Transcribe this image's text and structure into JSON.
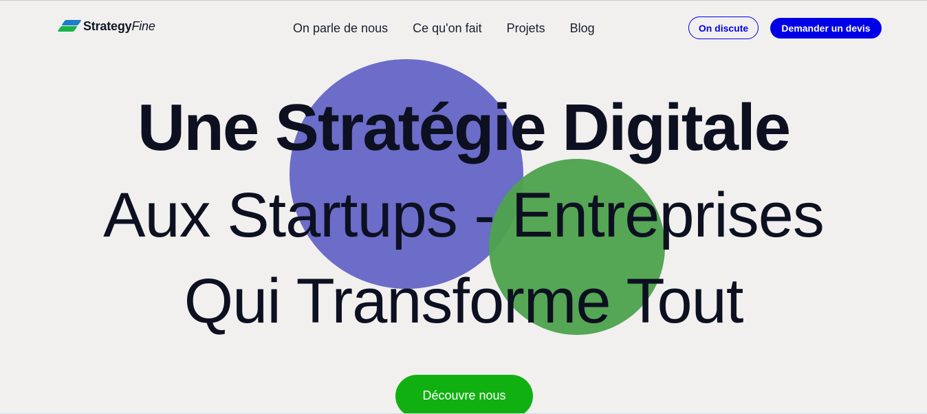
{
  "brand": {
    "name_bold": "Strategy",
    "name_italic": "Fine",
    "logo_icon": "stacked-parallelogram-logo",
    "colors": {
      "logo_blue": "#1e7ec9",
      "logo_green": "#19b34a"
    }
  },
  "nav": {
    "items": [
      {
        "label": "On parle de nous"
      },
      {
        "label": "Ce qu'on fait"
      },
      {
        "label": "Projets"
      },
      {
        "label": "Blog"
      }
    ]
  },
  "header_buttons": {
    "discuss_label": "On discute",
    "quote_label": "Demander un devis",
    "accent_color": "#0000e6"
  },
  "hero": {
    "line1": "Une Stratégie Digitale",
    "line2": "Aux Startups - Entreprises",
    "line3": "Qui Transforme Tout",
    "cta_label": "Découvre nous",
    "colors": {
      "purple_circle": "#6c6cc9",
      "green_circle": "#4ea24e",
      "cta": "#11b011",
      "background": "#f1f0ef"
    }
  }
}
